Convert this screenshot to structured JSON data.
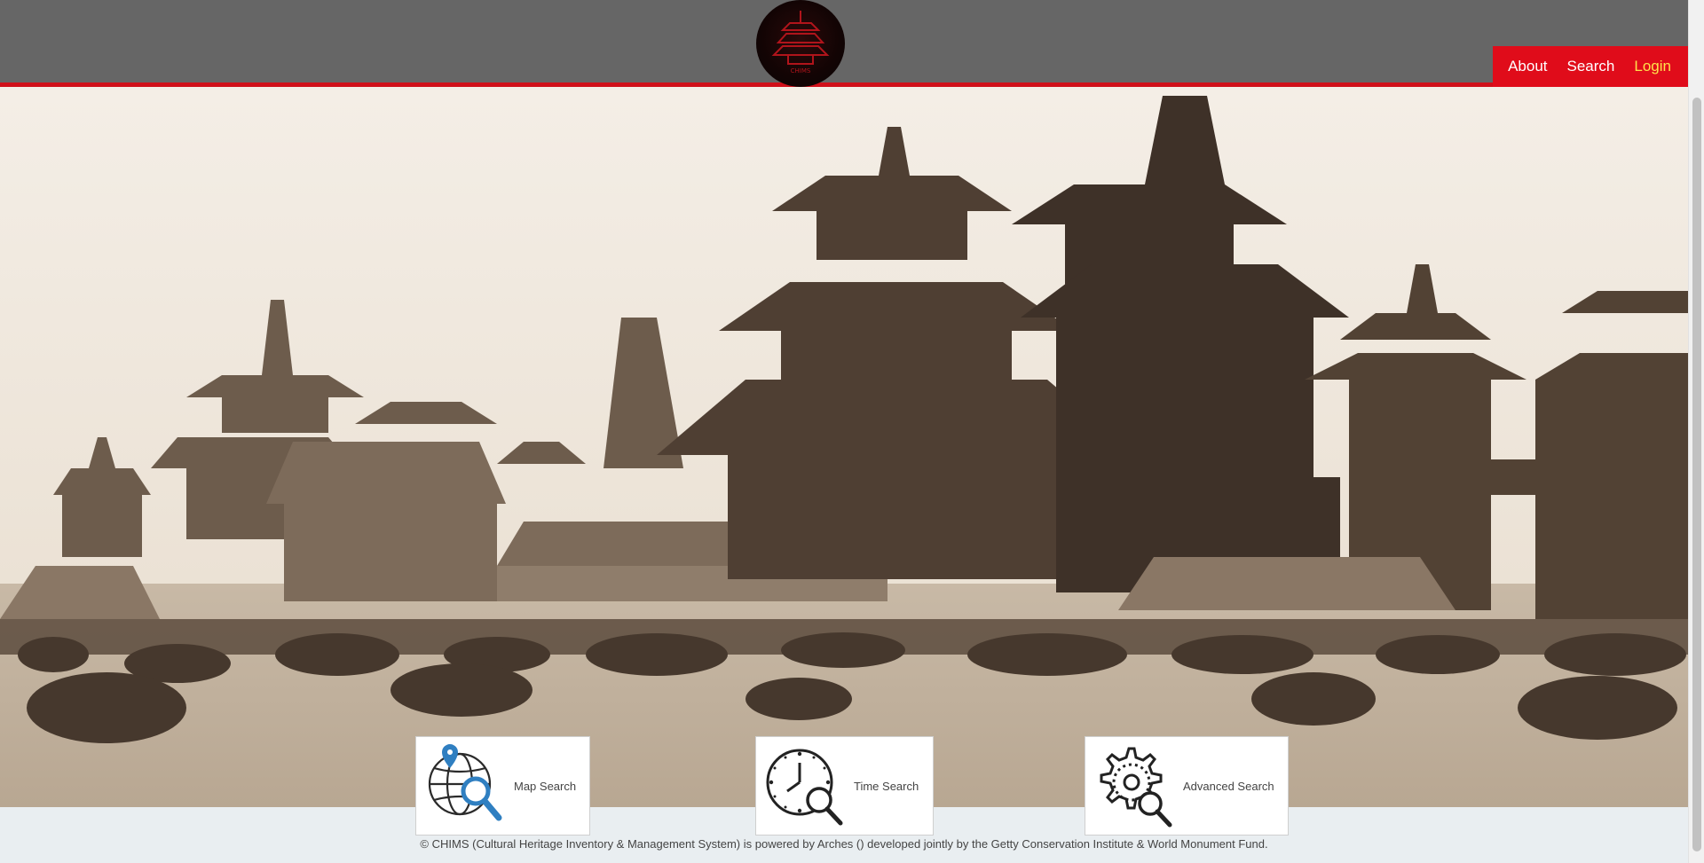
{
  "nav": {
    "about": "About",
    "search": "Search",
    "login": "Login"
  },
  "logo": {
    "text": "CHIMS"
  },
  "tiles": {
    "map_search": "Map Search",
    "time_search": "Time Search",
    "advanced_search": "Advanced Search"
  },
  "footer": {
    "text": "© CHIMS (Cultural Heritage Inventory & Management System) is powered by Arches () developed jointly by the Getty Conservation Institute & World Monument Fund."
  },
  "colors": {
    "header_bg": "#666666",
    "accent_red": "#e00c1a",
    "login_yellow": "#ffe14a",
    "icon_blue": "#2f7fc1"
  }
}
